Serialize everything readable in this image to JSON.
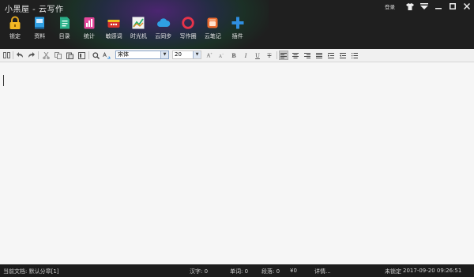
{
  "app": {
    "title": "小黑屋 - 云写作"
  },
  "window": {
    "login_label": "登录"
  },
  "toolbar": {
    "items": [
      {
        "label": "锁定",
        "icon": "lock-icon"
      },
      {
        "label": "资料",
        "icon": "book-icon"
      },
      {
        "label": "目录",
        "icon": "outline-icon"
      },
      {
        "label": "统计",
        "icon": "stats-icon"
      },
      {
        "label": "敏感词",
        "icon": "sensitive-words-icon"
      },
      {
        "label": "时光机",
        "icon": "time-machine-icon"
      },
      {
        "label": "云同步",
        "icon": "cloud-icon"
      },
      {
        "label": "写作圈",
        "icon": "ring-icon"
      },
      {
        "label": "云笔记",
        "icon": "note-icon"
      },
      {
        "label": "插件",
        "icon": "plus-icon"
      }
    ]
  },
  "format": {
    "font": "宋体",
    "size": "20",
    "bold": "B",
    "italic": "I",
    "underline": "U",
    "strike": "T"
  },
  "status": {
    "doc": "当前文档: 默认分章[1]",
    "chars": "汉字: 0",
    "words": "单词: 0",
    "paragraphs": "段落: 0",
    "money": "¥0",
    "details": "详情...",
    "lock_state": "未锁定",
    "datetime": "2017-09-20 09:26:51"
  },
  "colors": {
    "top_bar": "#1f1f1f",
    "editor_bg": "#f6f6f6",
    "status_bar": "#1c1c1c",
    "accent_blue": "#2f8ee0"
  }
}
